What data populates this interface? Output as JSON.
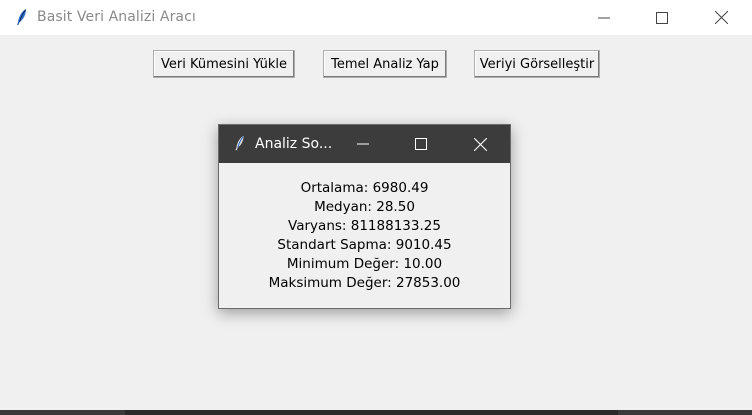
{
  "main_window": {
    "title": "Basit Veri Analizi Aracı",
    "icon": "feather-icon",
    "controls": [
      "minimize-icon",
      "maximize-icon",
      "close-icon"
    ]
  },
  "toolbar": {
    "load_label": "Veri Kümesini Yükle",
    "analyze_label": "Temel Analiz Yap",
    "visualize_label": "Veriyi Görselleştir"
  },
  "dialog": {
    "title": "Analiz So...",
    "icon": "feather-icon",
    "results": [
      "Ortalama: 6980.49",
      "Medyan: 28.50",
      "Varyans: 81188133.25",
      "Standart Sapma: 9010.45",
      "Minimum Değer: 10.00",
      "Maksimum Değer: 27853.00"
    ]
  },
  "colors": {
    "window_bg": "#f0f0f0",
    "titlebar_bg": "#ffffff",
    "dialog_titlebar_bg": "#3c3c3c"
  }
}
